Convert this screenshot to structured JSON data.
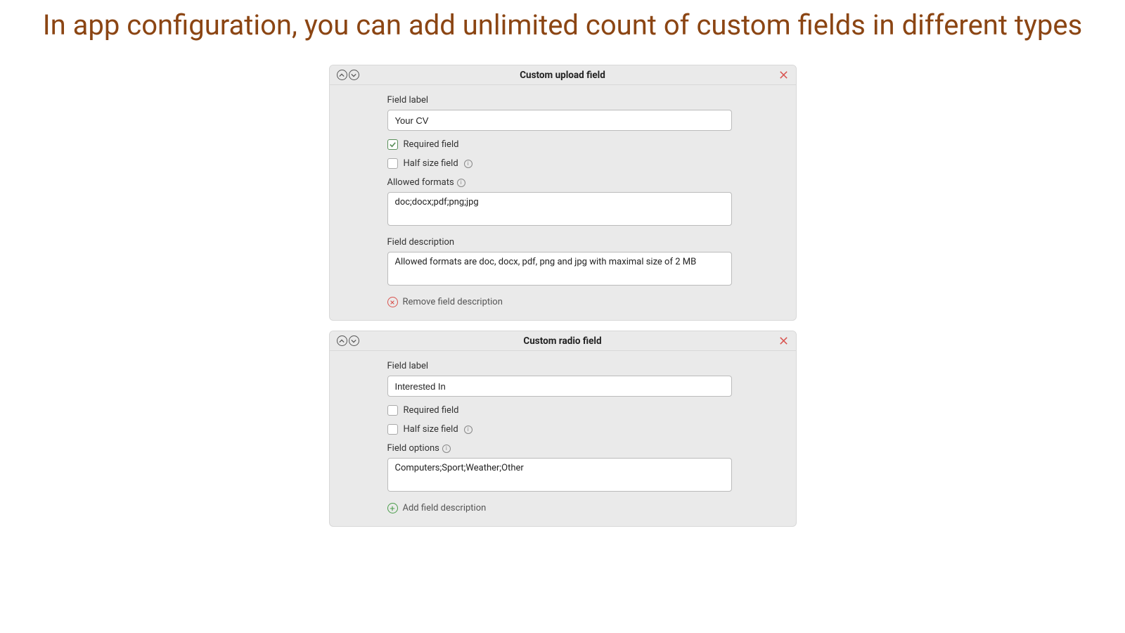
{
  "title": "In app configuration, you can add unlimited count of custom fields in different types",
  "labels": {
    "field_label": "Field label",
    "required_field": "Required field",
    "half_size_field": "Half size field",
    "allowed_formats": "Allowed formats",
    "field_description": "Field description",
    "field_options": "Field options",
    "remove_field_description": "Remove field description",
    "add_field_description": "Add field description"
  },
  "panels": [
    {
      "header": "Custom upload field",
      "field_label_value": "Your CV",
      "required_checked": true,
      "half_size_checked": false,
      "allowed_formats_value": "doc;docx;pdf;png;jpg",
      "field_description_value": "Allowed formats are doc, docx, pdf, png and jpg with maximal size of 2 MB",
      "has_description": true
    },
    {
      "header": "Custom radio field",
      "field_label_value": "Interested In",
      "required_checked": false,
      "half_size_checked": false,
      "field_options_value": "Computers;Sport;Weather;Other",
      "has_description": false
    }
  ]
}
